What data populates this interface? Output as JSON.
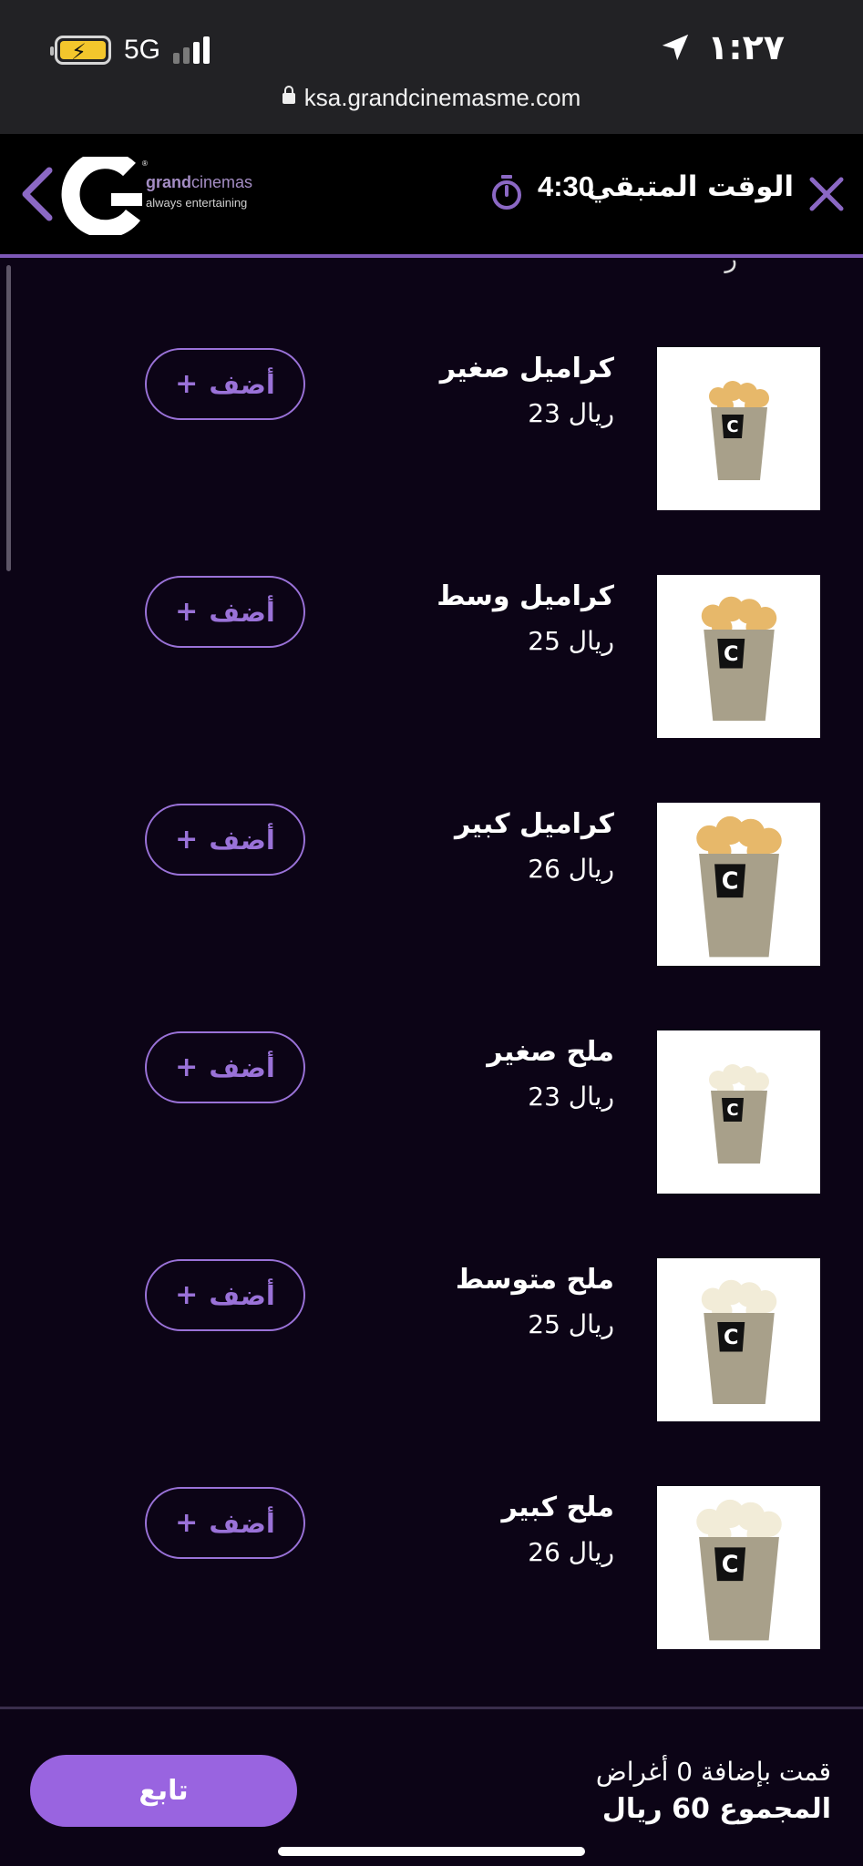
{
  "status_bar": {
    "network": "5G",
    "time": "١:٢٧",
    "url": "ksa.grandcinemasme.com"
  },
  "header": {
    "brand_bold": "grand",
    "brand_rest": "cinemas",
    "tagline": "always entertaining",
    "timer_label": "الوقت المتبقي",
    "timer_value": "4:30"
  },
  "items": [
    {
      "name": "كراميل صغير",
      "price": "ريال 23",
      "add_label": "أضف",
      "flavor": "caramel",
      "size": "small"
    },
    {
      "name": "كراميل وسط",
      "price": "ريال 25",
      "add_label": "أضف",
      "flavor": "caramel",
      "size": "medium"
    },
    {
      "name": "كراميل كبير",
      "price": "ريال 26",
      "add_label": "أضف",
      "flavor": "caramel",
      "size": "large"
    },
    {
      "name": "ملح صغير",
      "price": "ريال 23",
      "add_label": "أضف",
      "flavor": "salt",
      "size": "small"
    },
    {
      "name": "ملح متوسط",
      "price": "ريال 25",
      "add_label": "أضف",
      "flavor": "salt",
      "size": "medium"
    },
    {
      "name": "ملح كبير",
      "price": "ريال 26",
      "add_label": "أضف",
      "flavor": "salt",
      "size": "large"
    }
  ],
  "footer": {
    "added_text": "قمت بإضافة 0 أغراض",
    "total_text": "المجموع 60 ريال",
    "continue_label": "تابع"
  },
  "colors": {
    "accent": "#9a72d8",
    "button_fill": "#9964e0",
    "background": "#0c0416",
    "header_bg": "#000000",
    "status_bg": "#222225"
  }
}
